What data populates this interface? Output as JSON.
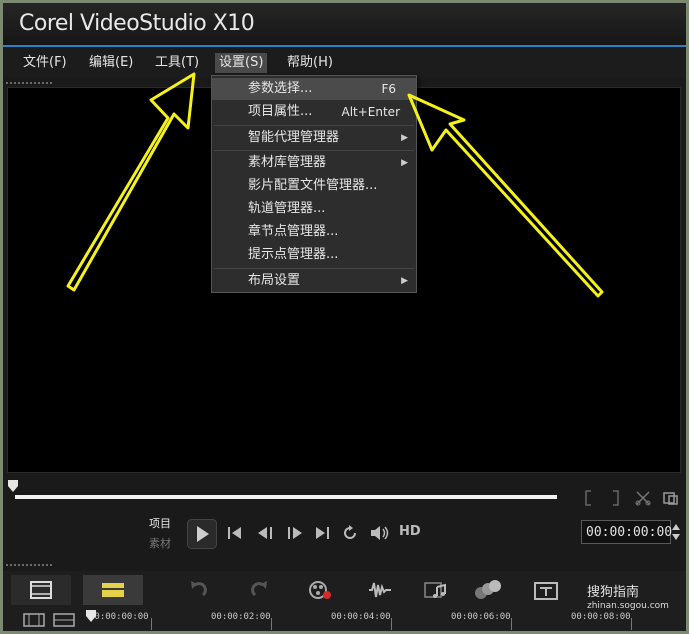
{
  "app": {
    "title": "Corel VideoStudio X10"
  },
  "menubar": {
    "items": [
      {
        "label": "文件(F)"
      },
      {
        "label": "编辑(E)"
      },
      {
        "label": "工具(T)"
      },
      {
        "label": "设置(S)"
      },
      {
        "label": "帮助(H)"
      }
    ]
  },
  "settings_menu": {
    "items": [
      {
        "label": "参数选择...",
        "shortcut": "F6"
      },
      {
        "label": "项目属性...",
        "shortcut": "Alt+Enter"
      },
      {
        "label": "智能代理管理器"
      },
      {
        "label": "素材库管理器"
      },
      {
        "label": "影片配置文件管理器..."
      },
      {
        "label": "轨道管理器..."
      },
      {
        "label": "章节点管理器..."
      },
      {
        "label": "提示点管理器..."
      },
      {
        "label": "布局设置"
      }
    ]
  },
  "player": {
    "mode_project": "项目",
    "mode_clip": "素材",
    "hd_label": "HD",
    "timecode": "00:00:00:00"
  },
  "timeline": {
    "ruler": [
      "00:00:00:00",
      "00:00:02:00",
      "00:00:04:00",
      "00:00:06:00",
      "00:00:08:00"
    ]
  },
  "watermark": {
    "text": "搜狗指南",
    "url": "zhinan.sogou.com"
  },
  "colors": {
    "accent_blue": "#2f7fc5",
    "annotation_arrow": "#f5f21a",
    "menu_highlight": "#4b4b4b"
  }
}
